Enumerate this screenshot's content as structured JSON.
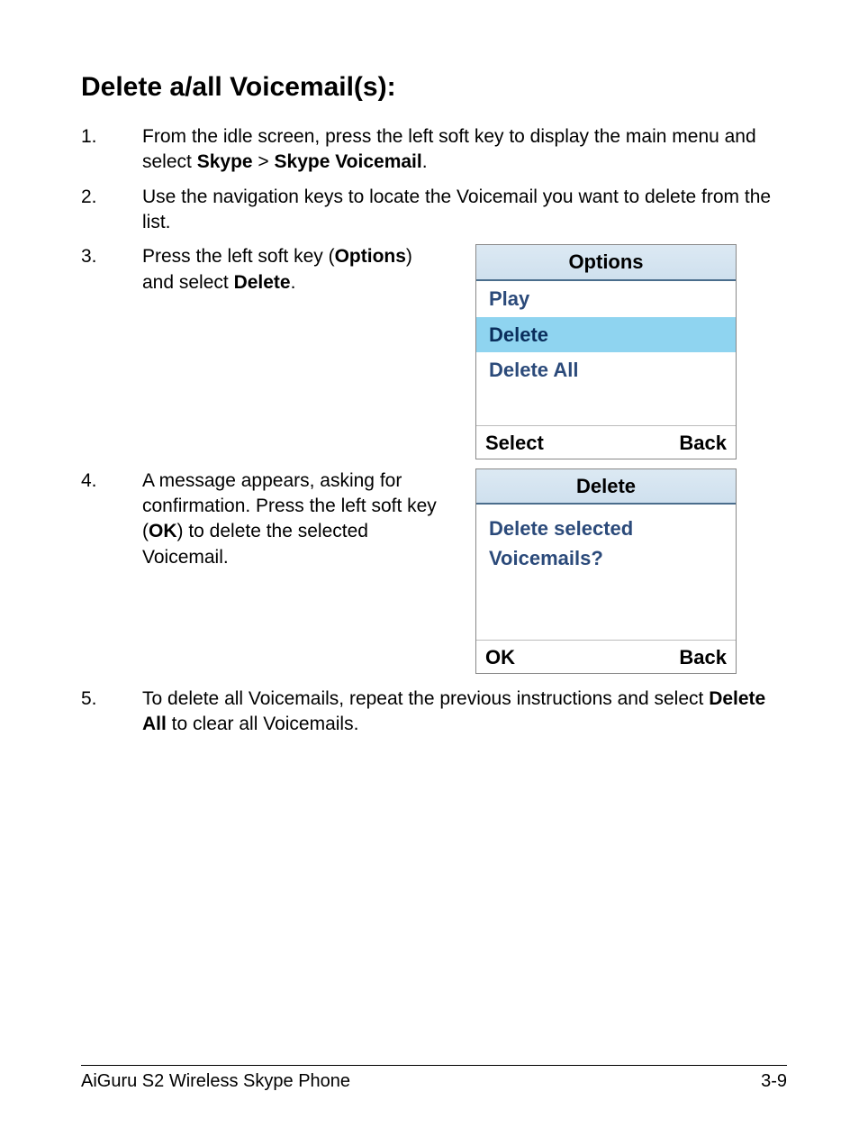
{
  "title": "Delete a/all Voicemail(s):",
  "steps": {
    "s1": {
      "num": "1.",
      "pre": "From the idle screen, press the left soft key to display the main menu and select ",
      "bold1": "Skype",
      "mid": " > ",
      "bold2": "Skype Voicemail",
      "post": "."
    },
    "s2": {
      "num": "2.",
      "text": "Use the navigation keys to locate the Voicemail you want to delete from the list."
    },
    "s3": {
      "num": "3.",
      "pre": "Press the left soft key (",
      "bold1": "Options",
      "mid": ") and select ",
      "bold2": "Delete",
      "post": "."
    },
    "s4": {
      "num": "4.",
      "pre": "A message appears, asking for confirmation. Press the left soft key (",
      "bold1": "OK",
      "post": ") to delete the selected Voicemail."
    },
    "s5": {
      "num": "5.",
      "pre": "To delete all Voicemails, repeat the previous instructions and select ",
      "bold1": "Delete All",
      "post": " to clear all Voicemails."
    }
  },
  "screen1": {
    "title": "Options",
    "items": [
      "Play",
      "Delete",
      "Delete All"
    ],
    "left": "Select",
    "right": "Back"
  },
  "screen2": {
    "title": "Delete",
    "line1": "Delete selected",
    "line2": "Voicemails?",
    "left": "OK",
    "right": "Back"
  },
  "footer": {
    "product": "AiGuru S2 Wireless Skype Phone",
    "page": "3-9"
  }
}
